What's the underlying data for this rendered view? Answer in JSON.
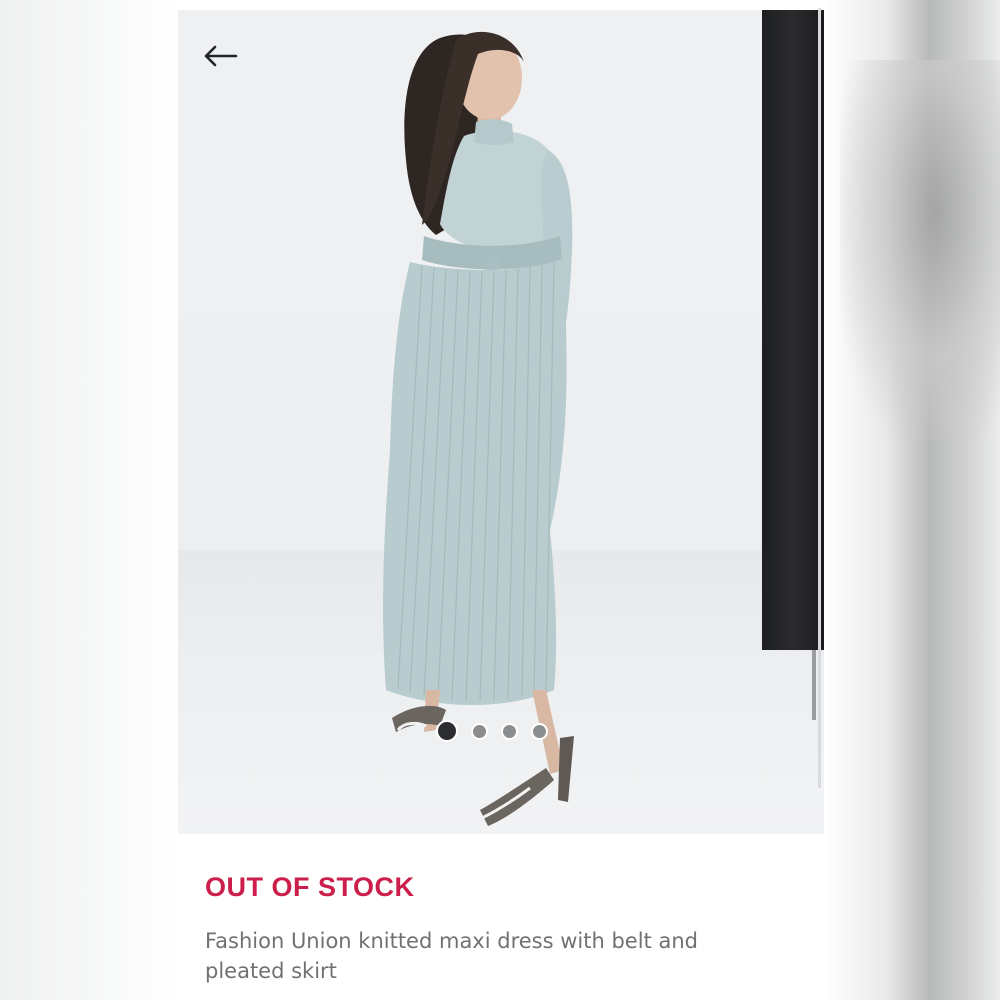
{
  "product": {
    "status": "OUT OF STOCK",
    "title": "Fashion Union knitted maxi dress with belt and pleated skirt"
  },
  "gallery": {
    "image_count": 4,
    "active_index": 0
  },
  "colors": {
    "status_accent": "#cc1e4a",
    "title_text": "#707174",
    "dress": "#b9cccf",
    "dot_active": "#2b2d30",
    "dot_inactive": "#8b8d8f"
  },
  "icons": {
    "back": "arrow-left-icon"
  }
}
